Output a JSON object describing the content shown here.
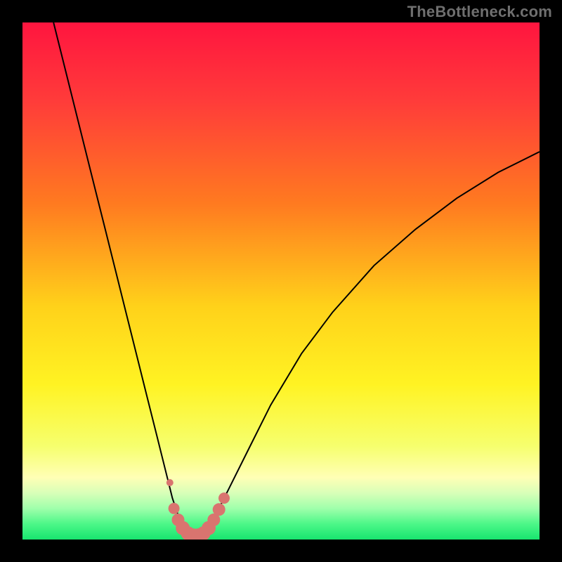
{
  "watermark": "TheBottleneck.com",
  "chart_data": {
    "type": "line",
    "title": "",
    "xlabel": "",
    "ylabel": "",
    "xlim": [
      0,
      100
    ],
    "ylim": [
      0,
      100
    ],
    "background": {
      "type": "vertical-gradient",
      "stops": [
        {
          "pos": 0.0,
          "color": "#ff153f"
        },
        {
          "pos": 0.15,
          "color": "#ff3b3a"
        },
        {
          "pos": 0.35,
          "color": "#ff7a20"
        },
        {
          "pos": 0.55,
          "color": "#ffd21a"
        },
        {
          "pos": 0.7,
          "color": "#fff323"
        },
        {
          "pos": 0.82,
          "color": "#f6ff6e"
        },
        {
          "pos": 0.88,
          "color": "#ffffb5"
        },
        {
          "pos": 0.91,
          "color": "#d8ffb8"
        },
        {
          "pos": 0.94,
          "color": "#9fffab"
        },
        {
          "pos": 0.97,
          "color": "#4cf788"
        },
        {
          "pos": 1.0,
          "color": "#18e56f"
        }
      ]
    },
    "series": [
      {
        "name": "bottleneck-curve",
        "color": "#000000",
        "stroke_width": 2,
        "x": [
          6,
          8,
          10,
          12,
          14,
          16,
          18,
          20,
          22,
          24,
          26,
          28,
          29,
          30,
          31,
          32,
          33,
          34,
          35,
          36,
          38,
          40,
          44,
          48,
          54,
          60,
          68,
          76,
          84,
          92,
          98,
          100
        ],
        "y": [
          100,
          92,
          84,
          76,
          68,
          60,
          52,
          44,
          36,
          28,
          20,
          12,
          8,
          5,
          2.5,
          1.2,
          0.6,
          0.6,
          1.2,
          2.5,
          6,
          10,
          18,
          26,
          36,
          44,
          53,
          60,
          66,
          71,
          74,
          75
        ]
      }
    ],
    "markers": {
      "name": "highlight-trough",
      "color": "#d9746f",
      "points": [
        {
          "x": 28.5,
          "y": 11.0,
          "r": 5
        },
        {
          "x": 29.3,
          "y": 6.0,
          "r": 8
        },
        {
          "x": 30.1,
          "y": 3.8,
          "r": 9
        },
        {
          "x": 31.0,
          "y": 2.2,
          "r": 10
        },
        {
          "x": 32.0,
          "y": 1.2,
          "r": 10
        },
        {
          "x": 33.0,
          "y": 0.8,
          "r": 10
        },
        {
          "x": 34.0,
          "y": 0.8,
          "r": 10
        },
        {
          "x": 35.0,
          "y": 1.2,
          "r": 10
        },
        {
          "x": 36.0,
          "y": 2.2,
          "r": 10
        },
        {
          "x": 37.0,
          "y": 3.8,
          "r": 9
        },
        {
          "x": 38.0,
          "y": 5.8,
          "r": 9
        },
        {
          "x": 39.0,
          "y": 8.0,
          "r": 8
        }
      ]
    }
  }
}
